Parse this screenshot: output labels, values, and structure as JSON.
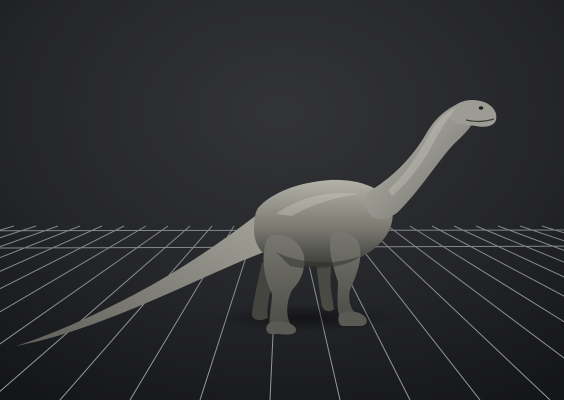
{
  "viewport": {
    "background_top": "#333438",
    "background_mid": "#25262a",
    "background_bottom": "#141517",
    "grid_color": "#9ea2a8",
    "grid_visible": true,
    "model": {
      "kind": "sauropod-dinosaur",
      "skin_light": "#b4b3aa",
      "skin_mid": "#7a7a72",
      "skin_dark": "#3a3a36"
    }
  }
}
